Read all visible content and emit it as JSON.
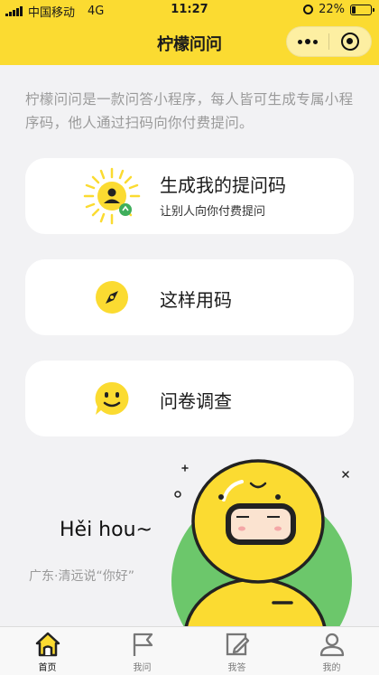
{
  "status_bar": {
    "carrier": "中国移动",
    "network": "4G",
    "time": "11:27",
    "battery": "22%",
    "battery_level": 0.22
  },
  "nav": {
    "title": "柠檬问问",
    "more_icon": "more-dots-icon",
    "close_icon": "close-target-icon"
  },
  "intro": {
    "text": "柠檬问问是一款问答小程序，每人皆可生成专属小程序码，他人通过扫码向你付费提问。"
  },
  "cards": [
    {
      "title": "生成我的提问码",
      "subtitle": "让别人向你付费提问",
      "icon": "sun-person-icon"
    },
    {
      "title": "这样用码",
      "icon": "compass-icon"
    },
    {
      "title": "问卷调查",
      "icon": "smiley-bubble-icon"
    }
  ],
  "promo": {
    "title": "Hěi hou~",
    "subtitle": "广东·清远说“你好”",
    "image": "lemon-mascot-illustration"
  },
  "tab_bar": {
    "tabs": [
      {
        "label": "首页",
        "icon": "home-icon",
        "active": true
      },
      {
        "label": "我问",
        "icon": "flag-icon",
        "active": false
      },
      {
        "label": "我答",
        "icon": "pen-paper-icon",
        "active": false
      },
      {
        "label": "我的",
        "icon": "user-icon",
        "active": false
      }
    ]
  },
  "colors": {
    "brand_yellow": "#fbdb31",
    "mascot_green": "#6cc76b",
    "background": "#f2f2f4"
  }
}
